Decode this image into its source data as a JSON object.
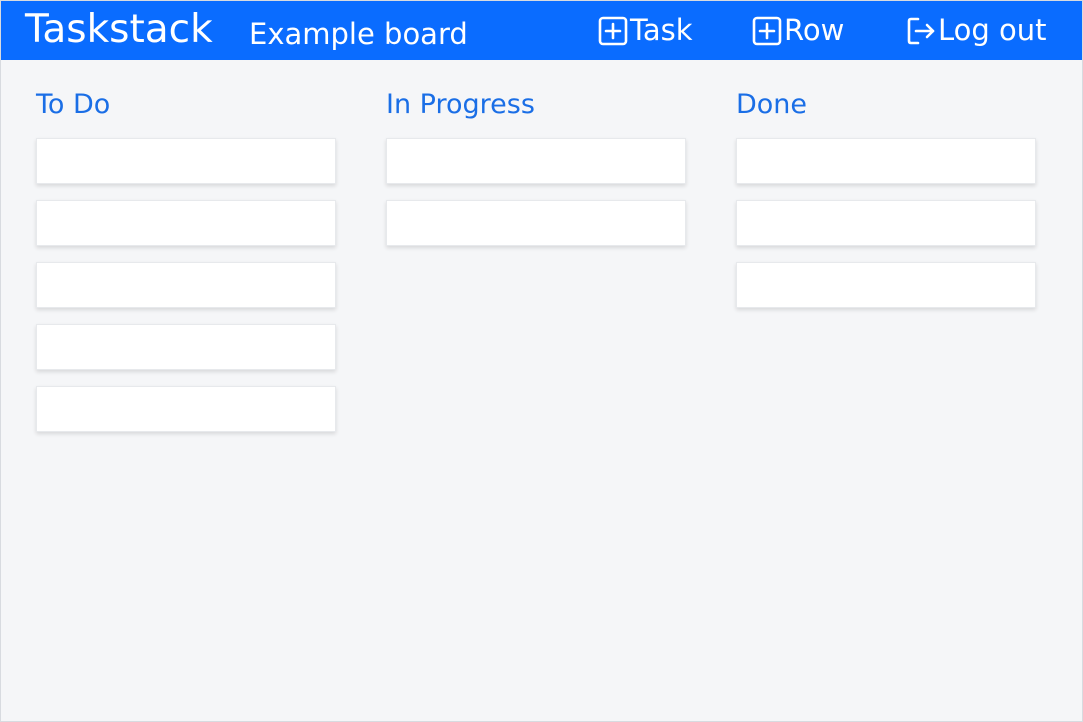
{
  "header": {
    "brand": "Taskstack",
    "board_name": "Example board",
    "background_color": "#0a6cff",
    "buttons": [
      {
        "label": "Task",
        "icon": "plus-square-icon"
      },
      {
        "label": "Row",
        "icon": "plus-square-icon"
      },
      {
        "label": "Log out",
        "icon": "logout-icon"
      }
    ]
  },
  "board": {
    "accent_color": "#1a6ee6",
    "columns": [
      {
        "title": "To Do",
        "card_count": 5
      },
      {
        "title": "In Progress",
        "card_count": 2
      },
      {
        "title": "Done",
        "card_count": 3
      }
    ]
  }
}
